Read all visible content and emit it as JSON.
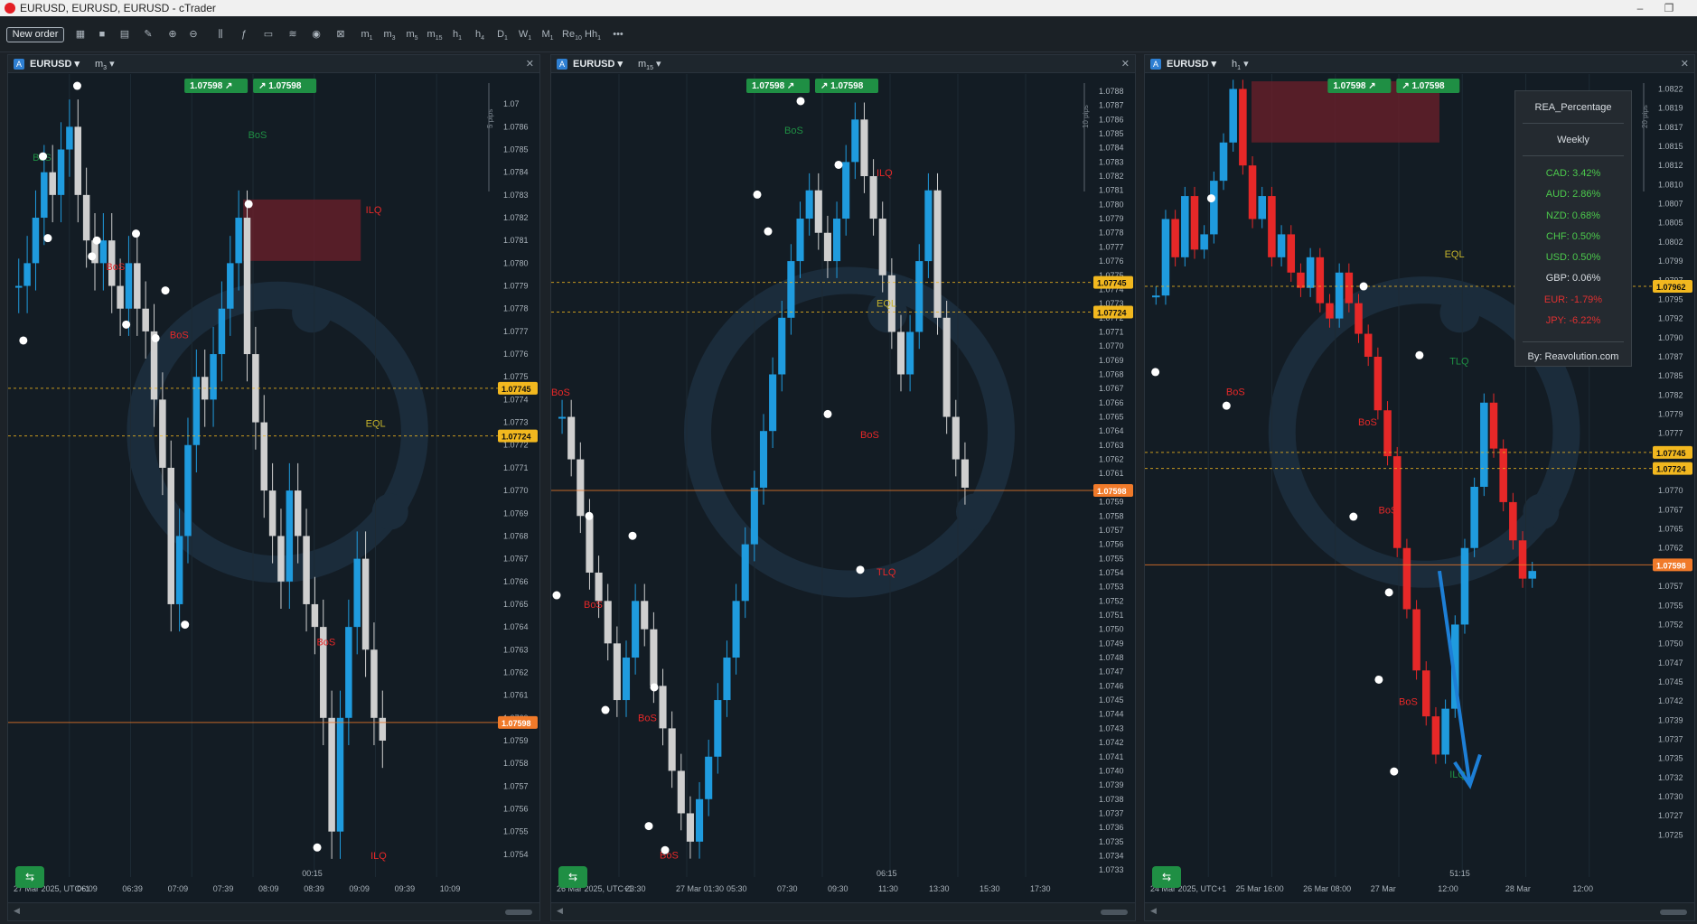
{
  "window": {
    "title": "EURUSD, EURUSD, EURUSD - cTrader",
    "min": "–",
    "max": "❐"
  },
  "toolbar": {
    "new_order": "New order",
    "timeframes": [
      {
        "l": "m",
        "s": "1"
      },
      {
        "l": "m",
        "s": "3"
      },
      {
        "l": "m",
        "s": "5"
      },
      {
        "l": "m",
        "s": "15"
      },
      {
        "l": "h",
        "s": "1"
      },
      {
        "l": "h",
        "s": "4"
      },
      {
        "l": "D",
        "s": "1"
      },
      {
        "l": "W",
        "s": "1"
      },
      {
        "l": "M",
        "s": "1"
      },
      {
        "l": "Re",
        "s": "10"
      },
      {
        "l": "Hh",
        "s": "1"
      }
    ],
    "more": "•••"
  },
  "colors": {
    "bg": "#131c24",
    "bull": "#1f9bde",
    "bear": "#cfcfcf",
    "red": "#e62828",
    "orange": "#f07a2a",
    "yellow": "#f2b81f",
    "green": "#1f8f44"
  },
  "panels": [
    {
      "id": "m3",
      "symbol": "EURUSD",
      "tf": "m",
      "tf_sub": "3",
      "bid": "1.0759",
      "bid_sup": "8",
      "ask": "1.0759",
      "ask_sup": "8",
      "pips": "5 pips",
      "clock": "00:15",
      "price_top": 1.0788,
      "price_bot": 1.0753,
      "tick_top": 1.0787,
      "tick_step": 0.0001,
      "tick_count": 34,
      "tick_first_label": "1.07",
      "hlines": [
        {
          "price": 1.07745,
          "label": "1.07745",
          "color": "#f2b81f"
        },
        {
          "price": 1.07724,
          "label": "1.07724",
          "color": "#f2b81f"
        },
        {
          "price": 1.07598,
          "label": "1.07598",
          "color": "#f07a2a"
        }
      ],
      "labels": [
        {
          "t": "BoS",
          "x": 0.49,
          "p": 1.07855,
          "c": "#1f8f44"
        },
        {
          "t": "BoS",
          "x": 0.05,
          "p": 1.07845,
          "c": "#1f8f44"
        },
        {
          "t": "ILQ",
          "x": 0.73,
          "p": 1.07822,
          "c": "#e62828"
        },
        {
          "t": "BoS",
          "x": 0.2,
          "p": 1.07797,
          "c": "#e62828"
        },
        {
          "t": "BoS",
          "x": 0.33,
          "p": 1.07767,
          "c": "#e62828"
        },
        {
          "t": "EQL",
          "x": 0.73,
          "p": 1.07728,
          "c": "#c5b32b"
        },
        {
          "t": "BoS",
          "x": 0.63,
          "p": 1.07632,
          "c": "#e62828"
        },
        {
          "t": "ILQ",
          "x": 0.74,
          "p": 1.07538,
          "c": "#e62828"
        }
      ],
      "dots": [
        [
          0.13,
          1.07878
        ],
        [
          0.06,
          1.07847
        ],
        [
          0.07,
          1.07811
        ],
        [
          0.17,
          1.0781
        ],
        [
          0.16,
          1.07803
        ],
        [
          0.25,
          1.07813
        ],
        [
          0.31,
          1.07788
        ],
        [
          0.23,
          1.07773
        ],
        [
          0.29,
          1.07767
        ],
        [
          0.02,
          1.07766
        ],
        [
          0.48,
          1.07826
        ],
        [
          0.35,
          1.07641
        ],
        [
          0.62,
          1.07543
        ]
      ],
      "zone": {
        "x0": 0.48,
        "x1": 0.72,
        "p0": 1.07828,
        "p1": 1.07801
      },
      "xlabels": [
        "27 Mar 2025, UTC+1",
        "06:09",
        "06:39",
        "07:09",
        "07:39",
        "08:09",
        "08:39",
        "09:09",
        "09:39",
        "10:09"
      ],
      "candles": [
        1.0779,
        1.078,
        1.0782,
        1.0784,
        1.0783,
        1.0785,
        1.0786,
        1.0783,
        1.0781,
        1.078,
        1.0781,
        1.0779,
        1.0778,
        1.078,
        1.0778,
        1.0777,
        1.0774,
        1.0771,
        1.0765,
        1.0768,
        1.0772,
        1.0775,
        1.0774,
        1.0776,
        1.0778,
        1.078,
        1.0782,
        1.0776,
        1.0773,
        1.077,
        1.0768,
        1.0766,
        1.077,
        1.0768,
        1.0765,
        1.0764,
        1.076,
        1.0755,
        1.076,
        1.0764,
        1.0767,
        1.0763,
        1.076,
        1.0759
      ]
    },
    {
      "id": "m15",
      "symbol": "EURUSD",
      "tf": "m",
      "tf_sub": "15",
      "bid": "1.0759",
      "bid_sup": "8",
      "ask": "1.0759",
      "ask_sup": "8",
      "pips": "10 pips",
      "clock": "06:15",
      "price_top": 1.07887,
      "price_bot": 1.07325,
      "tick_top": 1.0789,
      "tick_step": 0.0001,
      "tick_count": 57,
      "tick_first_label": "1.0789",
      "hlines": [
        {
          "price": 1.07745,
          "label": "1.07745",
          "color": "#f2b81f"
        },
        {
          "price": 1.07724,
          "label": "1.07724",
          "color": "#f2b81f"
        },
        {
          "price": 1.07598,
          "label": "1.07598",
          "color": "#f07a2a"
        }
      ],
      "labels": [
        {
          "t": "BoS",
          "x": 0.43,
          "p": 1.0785,
          "c": "#1f8f44"
        },
        {
          "t": "ILQ",
          "x": 0.6,
          "p": 1.0782,
          "c": "#e62828"
        },
        {
          "t": "EQL",
          "x": 0.6,
          "p": 1.07728,
          "c": "#c5b32b"
        },
        {
          "t": "BoS",
          "x": 0.0,
          "p": 1.07665,
          "c": "#e62828"
        },
        {
          "t": "BoS",
          "x": 0.57,
          "p": 1.07635,
          "c": "#e62828"
        },
        {
          "t": "TLQ",
          "x": 0.6,
          "p": 1.07538,
          "c": "#e62828"
        },
        {
          "t": "BoS",
          "x": 0.06,
          "p": 1.07515,
          "c": "#e62828"
        },
        {
          "t": "BoS",
          "x": 0.16,
          "p": 1.07435,
          "c": "#e62828"
        },
        {
          "t": "BoS",
          "x": 0.2,
          "p": 1.07338,
          "c": "#e62828"
        }
      ],
      "dots": [
        [
          0.45,
          1.07873
        ],
        [
          0.52,
          1.07828
        ],
        [
          0.37,
          1.07807
        ],
        [
          0.39,
          1.07781
        ],
        [
          0.5,
          1.07652
        ],
        [
          0.06,
          1.0758
        ],
        [
          0.14,
          1.07566
        ],
        [
          0.0,
          1.07524
        ],
        [
          0.09,
          1.07443
        ],
        [
          0.18,
          1.07459
        ],
        [
          0.17,
          1.07361
        ],
        [
          0.2,
          1.07344
        ],
        [
          0.56,
          1.07542
        ]
      ],
      "zone": null,
      "xlabels": [
        "26 Mar 2025, UTC+1",
        "23:30",
        "27 Mar 01:30",
        "05:30",
        "07:30",
        "09:30",
        "11:30",
        "13:30",
        "15:30",
        "17:30"
      ],
      "candles": [
        1.0765,
        1.0762,
        1.0758,
        1.0754,
        1.0752,
        1.0749,
        1.0745,
        1.0748,
        1.0752,
        1.075,
        1.0746,
        1.0743,
        1.074,
        1.0737,
        1.0735,
        1.0738,
        1.0741,
        1.0745,
        1.0748,
        1.0752,
        1.0756,
        1.076,
        1.0764,
        1.0768,
        1.0772,
        1.0776,
        1.0779,
        1.0781,
        1.0778,
        1.0776,
        1.0779,
        1.0783,
        1.0786,
        1.0782,
        1.0779,
        1.0775,
        1.0771,
        1.0768,
        1.0771,
        1.0776,
        1.0781,
        1.0772,
        1.0765,
        1.0762,
        1.076
      ]
    },
    {
      "id": "h1",
      "symbol": "EURUSD",
      "tf": "h",
      "tf_sub": "1",
      "bid": "1.0759",
      "bid_sup": "8",
      "ask": "1.0759",
      "ask_sup": "8",
      "pips": "20 pips",
      "clock": "51:15",
      "price_top": 1.0823,
      "price_bot": 1.0719,
      "tick_top": 1.0822,
      "tick_step": 0.00025,
      "tick_count": 40,
      "tick_first_label": "1.0822",
      "hlines": [
        {
          "price": 1.07962,
          "label": "1.07962",
          "color": "#f2b81f"
        },
        {
          "price": 1.07745,
          "label": "1.07745",
          "color": "#f2b81f"
        },
        {
          "price": 1.07724,
          "label": "1.07724",
          "color": "#f2b81f"
        },
        {
          "price": 1.07598,
          "label": "1.07598",
          "color": "#f07a2a"
        }
      ],
      "labels": [
        {
          "t": "EQL",
          "x": 0.59,
          "p": 1.08,
          "c": "#c5b32b"
        },
        {
          "t": "TLQ",
          "x": 0.6,
          "p": 1.0786,
          "c": "#1f8f44"
        },
        {
          "t": "BoS",
          "x": 0.16,
          "p": 1.0782,
          "c": "#e62828"
        },
        {
          "t": "BoS",
          "x": 0.42,
          "p": 1.0778,
          "c": "#e62828"
        },
        {
          "t": "BoS",
          "x": 0.46,
          "p": 1.07665,
          "c": "#e62828"
        },
        {
          "t": "BoS",
          "x": 0.5,
          "p": 1.07415,
          "c": "#e62828"
        },
        {
          "t": "ILQ",
          "x": 0.6,
          "p": 1.0732,
          "c": "#1f8f44"
        }
      ],
      "dots": [
        [
          0.12,
          1.08077
        ],
        [
          0.42,
          1.07962
        ],
        [
          0.53,
          1.07872
        ],
        [
          0.01,
          1.0785
        ],
        [
          0.15,
          1.07806
        ],
        [
          0.4,
          1.07661
        ],
        [
          0.47,
          1.07562
        ],
        [
          0.45,
          1.07448
        ],
        [
          0.48,
          1.07328
        ]
      ],
      "zone": {
        "x0": 0.21,
        "x1": 0.58,
        "p0": 1.0823,
        "p1": 1.0815
      },
      "xlabels": [
        "24 Mar 2025, UTC+1",
        "25 Mar 16:00",
        "26 Mar 08:00",
        "27 Mar",
        "12:00",
        "28 Mar",
        "12:00"
      ],
      "candles": [
        1.0795,
        1.0805,
        1.08,
        1.0808,
        1.0801,
        1.0803,
        1.081,
        1.0815,
        1.0822,
        1.0812,
        1.0805,
        1.0808,
        1.08,
        1.0803,
        1.0798,
        1.0796,
        1.08,
        1.0794,
        1.0792,
        1.0798,
        1.0794,
        1.079,
        1.0787,
        1.078,
        1.0774,
        1.0762,
        1.0754,
        1.0746,
        1.074,
        1.0735,
        1.0741,
        1.0752,
        1.0762,
        1.077,
        1.0781,
        1.0775,
        1.0768,
        1.0763,
        1.0758,
        1.0759
      ]
    }
  ],
  "rea": {
    "title": "REA_Percentage",
    "period": "Weekly",
    "rows": [
      {
        "t": "CAD: 3.42%",
        "c": "#4cc94c"
      },
      {
        "t": "AUD: 2.86%",
        "c": "#4cc94c"
      },
      {
        "t": "NZD: 0.68%",
        "c": "#4cc94c"
      },
      {
        "t": "CHF: 0.50%",
        "c": "#4cc94c"
      },
      {
        "t": "USD: 0.50%",
        "c": "#4cc94c"
      },
      {
        "t": "GBP: 0.06%",
        "c": "#d9dee3"
      },
      {
        "t": "EUR: -1.79%",
        "c": "#e03030"
      },
      {
        "t": "JPY: -6.22%",
        "c": "#e03030"
      }
    ],
    "by": "By: Reavolution.com"
  }
}
